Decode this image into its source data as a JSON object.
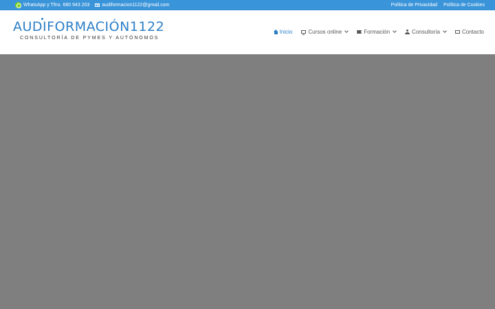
{
  "topbar": {
    "phone": "WhatsApp y Tfno. 680 943 203",
    "email": "audiformacion1122@gmail.com",
    "links": [
      "Política de Privacidad",
      "Política de Cookies"
    ]
  },
  "logo": {
    "name": "AUDIFORMACIÓN1122",
    "tagline": "CONSULTORÍA DE PYMES Y AUTÓNOMOS"
  },
  "nav": {
    "items": [
      {
        "label": "Inicio",
        "icon": "home-icon",
        "active": true
      },
      {
        "label": "Cursos online",
        "icon": "monitor-icon",
        "dropdown": true
      },
      {
        "label": "Formación",
        "icon": "flag-icon",
        "dropdown": true
      },
      {
        "label": "Consultoría",
        "icon": "user-icon",
        "dropdown": true
      },
      {
        "label": "Contacto",
        "icon": "mail-icon"
      }
    ]
  },
  "colors": {
    "topbar": "#3a94d9",
    "brand": "#2b7ec6",
    "hero": "#7f7f7f"
  }
}
